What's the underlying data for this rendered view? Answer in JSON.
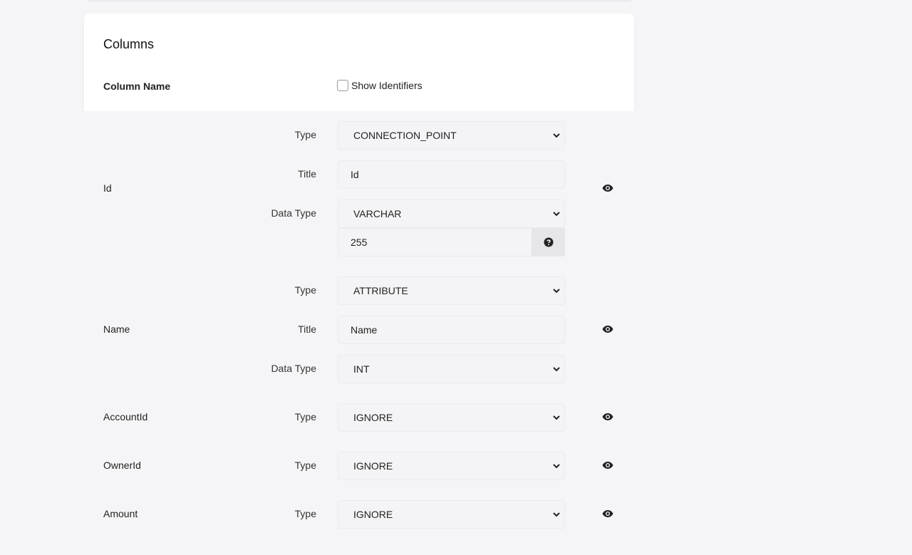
{
  "card": {
    "title": "Columns",
    "column_name_header": "Column Name",
    "show_identifiers_label": "Show Identifiers"
  },
  "labels": {
    "type": "Type",
    "title": "Title",
    "data_type": "Data Type"
  },
  "rows": [
    {
      "name": "Id",
      "type": "CONNECTION_POINT",
      "title": "Id",
      "data_type": "VARCHAR",
      "length": "255"
    },
    {
      "name": "Name",
      "type": "ATTRIBUTE",
      "title": "Name",
      "data_type": "INT"
    },
    {
      "name": "AccountId",
      "type": "IGNORE"
    },
    {
      "name": "OwnerId",
      "type": "IGNORE"
    },
    {
      "name": "Amount",
      "type": "IGNORE"
    }
  ],
  "icons": {
    "eye": "eye-icon",
    "help": "question-circle-icon",
    "chevron": "chevron-down-icon"
  }
}
